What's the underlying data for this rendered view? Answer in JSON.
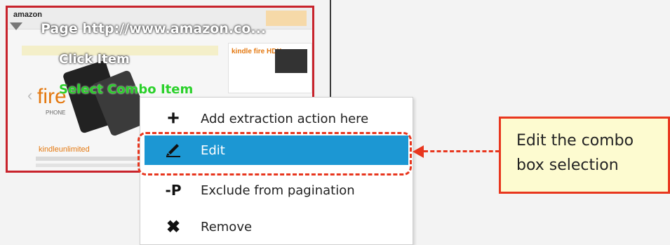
{
  "thumbnail": {
    "logo_text": "amazon",
    "fire_text": "fire",
    "fire_sub": "PHONE",
    "kindle_text": "kindleunlimited",
    "right_panel_title": "kindle fire HDX"
  },
  "overlay_labels": {
    "page": "Page  http://www.amazon.co...",
    "click": "Click Item",
    "combo": "Select Combo Item"
  },
  "context_menu": {
    "items": [
      {
        "label": "Add extraction action here",
        "icon": "plus-icon",
        "glyph": "+"
      },
      {
        "label": "Edit",
        "icon": "pencil-icon",
        "glyph": "✎",
        "selected": true
      },
      {
        "label": "Exclude from pagination",
        "icon": "minus-p-icon",
        "glyph": "-P"
      },
      {
        "label": "Remove",
        "icon": "close-icon",
        "glyph": "✖"
      }
    ]
  },
  "callout": {
    "text": "Edit the combo\nbox selection"
  },
  "colors": {
    "accent_red": "#e8361e",
    "selection_blue": "#1c97d3",
    "callout_bg": "#fdfbd0",
    "combo_green": "#2ad02a"
  }
}
